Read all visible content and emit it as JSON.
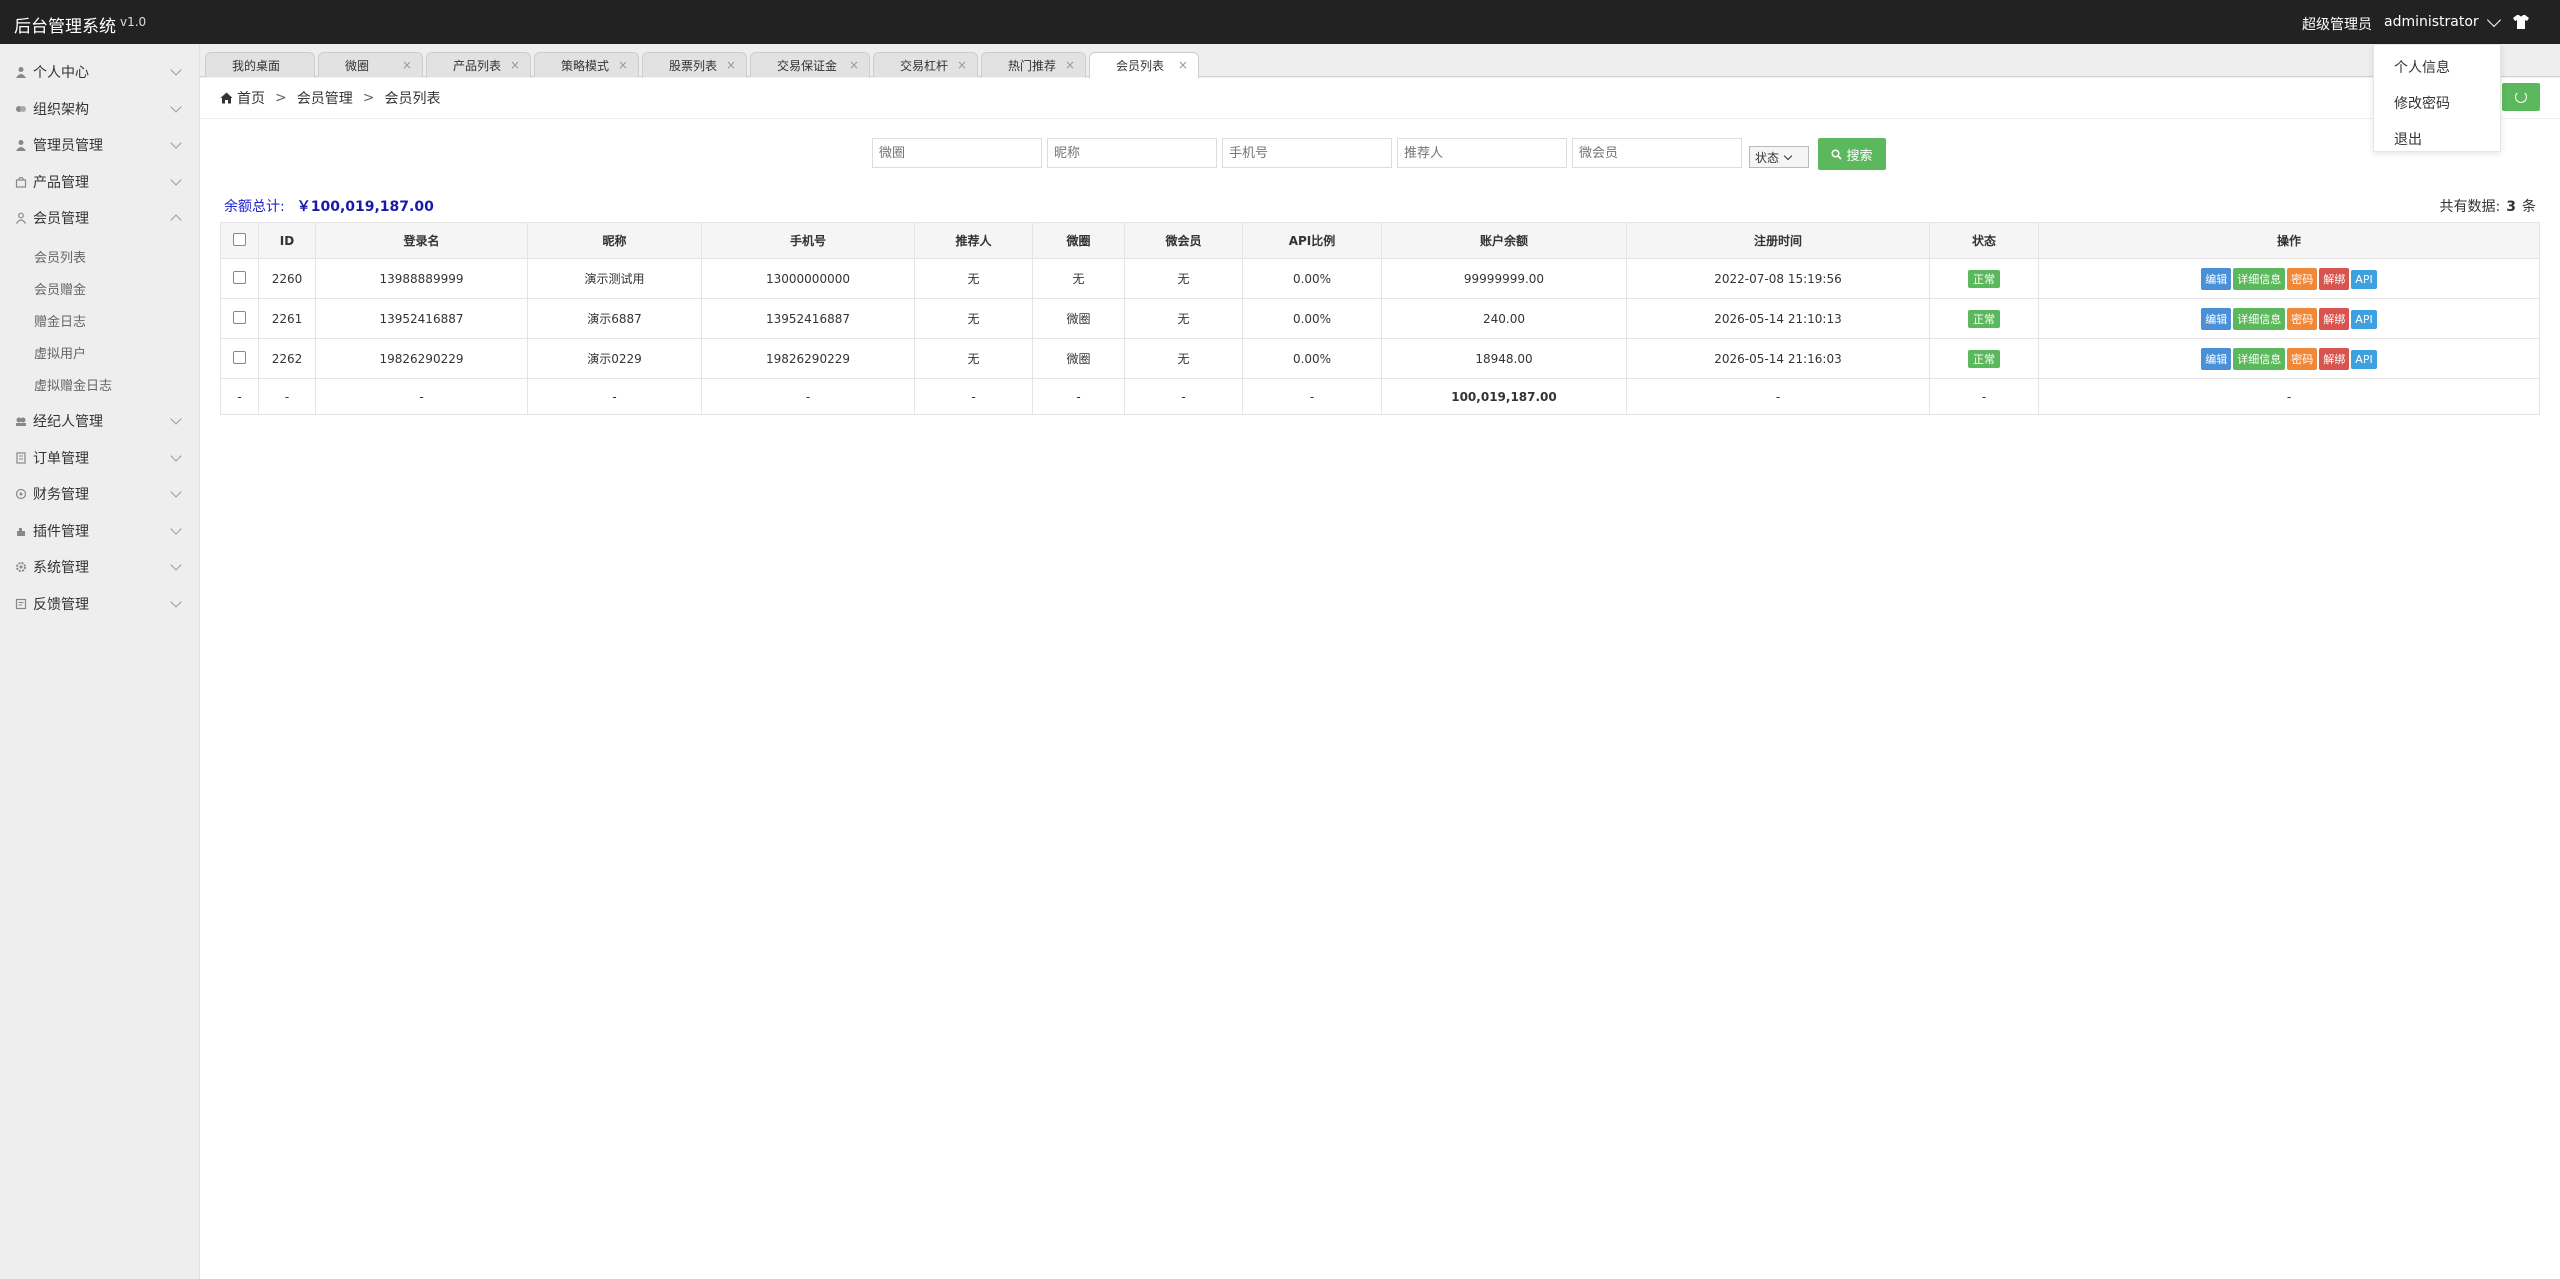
{
  "header": {
    "title": "后台管理系统",
    "version": "v1.0",
    "role": "超级管理员",
    "username": "administrator",
    "skin_icon": "tshirt-icon"
  },
  "user_menu": {
    "items": [
      "个人信息",
      "修改密码",
      "退出"
    ]
  },
  "sidebar": {
    "items": [
      {
        "label": "个人中心",
        "icon": "user-icon"
      },
      {
        "label": "组织架构",
        "icon": "org-icon"
      },
      {
        "label": "管理员管理",
        "icon": "admin-icon"
      },
      {
        "label": "产品管理",
        "icon": "bag-icon"
      },
      {
        "label": "会员管理",
        "icon": "member-icon",
        "expanded": true
      },
      {
        "label": "经纪人管理",
        "icon": "broker-icon"
      },
      {
        "label": "订单管理",
        "icon": "order-icon"
      },
      {
        "label": "财务管理",
        "icon": "finance-icon"
      },
      {
        "label": "插件管理",
        "icon": "plugin-icon"
      },
      {
        "label": "系统管理",
        "icon": "gear-icon"
      },
      {
        "label": "反馈管理",
        "icon": "feedback-icon"
      }
    ],
    "sub_items": [
      "会员列表",
      "会员赠金",
      "赠金日志",
      "虚拟用户",
      "虚拟赠金日志"
    ]
  },
  "tabs": [
    {
      "label": "我的桌面"
    },
    {
      "label": "微圈"
    },
    {
      "label": "产品列表"
    },
    {
      "label": "策略模式"
    },
    {
      "label": "股票列表"
    },
    {
      "label": "交易保证金"
    },
    {
      "label": "交易杠杆"
    },
    {
      "label": "热门推荐"
    },
    {
      "label": "会员列表",
      "active": true
    }
  ],
  "breadcrumb": {
    "home": "首页",
    "sep": ">",
    "level1": "会员管理",
    "level2": "会员列表"
  },
  "search": {
    "placeholders": [
      "微圈",
      "昵称",
      "手机号",
      "推荐人",
      "微会员"
    ],
    "status_select": "状态",
    "button": "搜索"
  },
  "summary": {
    "label": "余额总计:",
    "value": "￥100,019,187.00"
  },
  "total": {
    "prefix": "共有数据:",
    "count": "3",
    "suffix": "条"
  },
  "table": {
    "headers": [
      "ID",
      "登录名",
      "昵称",
      "手机号",
      "推荐人",
      "微圈",
      "微会员",
      "API比例",
      "账户余额",
      "注册时间",
      "状态",
      "操作"
    ],
    "rows": [
      {
        "id": "2260",
        "login": "13988889999",
        "nick": "演示测试用",
        "phone": "13000000000",
        "ref": "无",
        "circle": "无",
        "vip": "无",
        "api": "0.00%",
        "balance": "99999999.00",
        "time": "2022-07-08 15:19:56",
        "status": "正常"
      },
      {
        "id": "2261",
        "login": "13952416887",
        "nick": "演示6887",
        "phone": "13952416887",
        "ref": "无",
        "circle": "微圈",
        "vip": "无",
        "api": "0.00%",
        "balance": "240.00",
        "time": "2026-05-14 21:10:13",
        "status": "正常"
      },
      {
        "id": "2262",
        "login": "19826290229",
        "nick": "演示0229",
        "phone": "19826290229",
        "ref": "无",
        "circle": "微圈",
        "vip": "无",
        "api": "0.00%",
        "balance": "18948.00",
        "time": "2026-05-14 21:16:03",
        "status": "正常"
      }
    ],
    "actions": [
      "编辑",
      "详细信息",
      "密码",
      "解绑",
      "API"
    ],
    "sum_row": {
      "dash": "-",
      "balance": "100,019,187.00"
    }
  },
  "colors": {
    "topbar": "#222222",
    "green": "#5cb85c",
    "summary_blue": "#2222cc"
  }
}
